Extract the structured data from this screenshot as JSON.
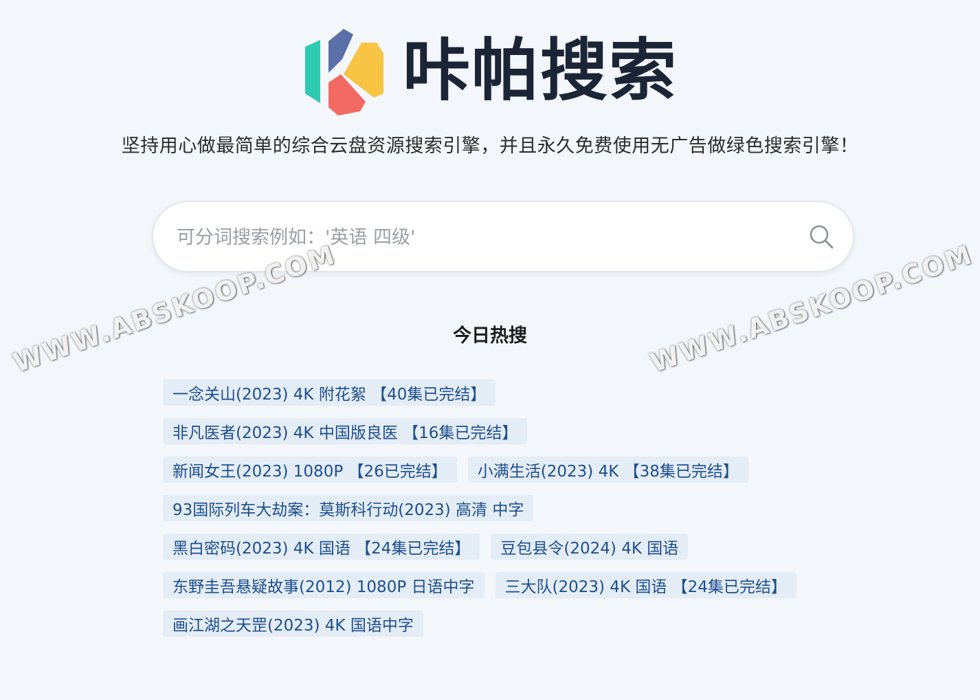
{
  "brand": {
    "name": "咔帕搜索",
    "slogan": "坚持用心做最简单的综合云盘资源搜索引擎，并且永久免费使用无广告做绿色搜索引擎！",
    "logo_colors": [
      "#2ecbb3",
      "#5b6fa8",
      "#f7c443",
      "#f36a63"
    ]
  },
  "search": {
    "placeholder": "可分词搜索例如：'英语 四级'",
    "value": "",
    "icon": "search-icon"
  },
  "hot": {
    "title": "今日热搜",
    "rows": [
      [
        "一念关山(2023) 4K 附花絮 【40集已完结】"
      ],
      [
        "非凡医者(2023) 4K 中国版良医 【16集已完结】"
      ],
      [
        "新闻女王(2023) 1080P 【26已完结】",
        "小满生活(2023) 4K 【38集已完结】"
      ],
      [
        "93国际列车大劫案：莫斯科行动(2023) 高清 中字"
      ],
      [
        "黑白密码(2023) 4K 国语 【24集已完结】",
        "豆包县令(2024) 4K 国语"
      ],
      [
        "东野圭吾悬疑故事(2012) 1080P 日语中字",
        "三大队(2023) 4K 国语 【24集已完结】"
      ],
      [
        "画江湖之天罡(2023) 4K 国语中字"
      ]
    ]
  },
  "watermark": {
    "text_top": "WWW.",
    "text": "WWW.ABSKOOP.COM"
  }
}
